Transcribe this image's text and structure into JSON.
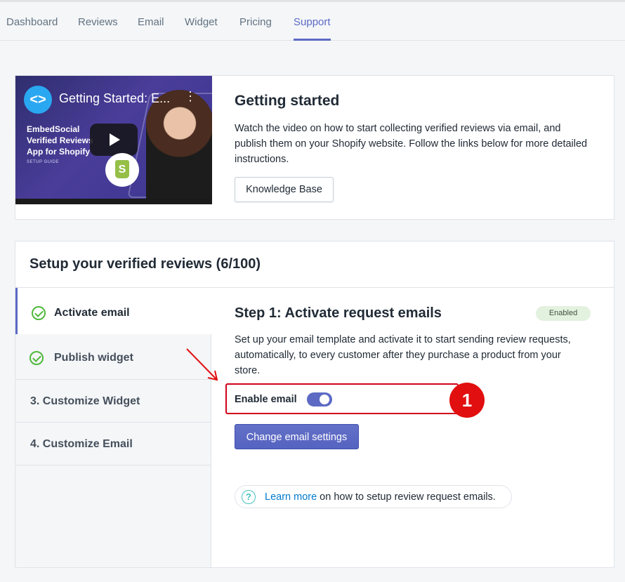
{
  "nav": {
    "tabs": [
      "Dashboard",
      "Reviews",
      "Email",
      "Widget",
      "Pricing",
      "Support"
    ],
    "active_tab": "Support"
  },
  "getting_started": {
    "video": {
      "logo_glyph": "<>",
      "title": "Getting Started: E...",
      "brand_text": "EmbedSocial Verified Reviews App for Shopify",
      "guide_text": "SETUP GUIDE",
      "shop_glyph": "S"
    },
    "title": "Getting started",
    "description": "Watch the video on how to start collecting verified reviews via email, and publish them on your Shopify website. Follow the links below for more detailed instructions.",
    "button_label": "Knowledge Base"
  },
  "setup": {
    "title": "Setup your verified reviews (6/100)",
    "steps": [
      {
        "label": "Activate email",
        "done": true,
        "active": true
      },
      {
        "label": "Publish widget",
        "done": true,
        "active": false
      },
      {
        "label": "3.  Customize Widget",
        "done": false,
        "active": false
      },
      {
        "label": "4.  Customize Email",
        "done": false,
        "active": false
      }
    ],
    "step1": {
      "title": "Step 1: Activate request emails",
      "status_badge": "Enabled",
      "description": "Set up your email template and activate it to start sending review requests, automatically, to every customer after they purchase a product from your store.",
      "enable_label": "Enable email",
      "enable_on": true,
      "annotation_number": "1",
      "settings_button": "Change email settings",
      "learn_more_link": "Learn more",
      "learn_more_rest": " on how to setup review request emails.",
      "help_glyph": "?"
    }
  },
  "colors": {
    "accent": "#5c6ac4",
    "success": "#50b83c",
    "annotation_red": "#e10f0f",
    "link": "#007ace"
  }
}
